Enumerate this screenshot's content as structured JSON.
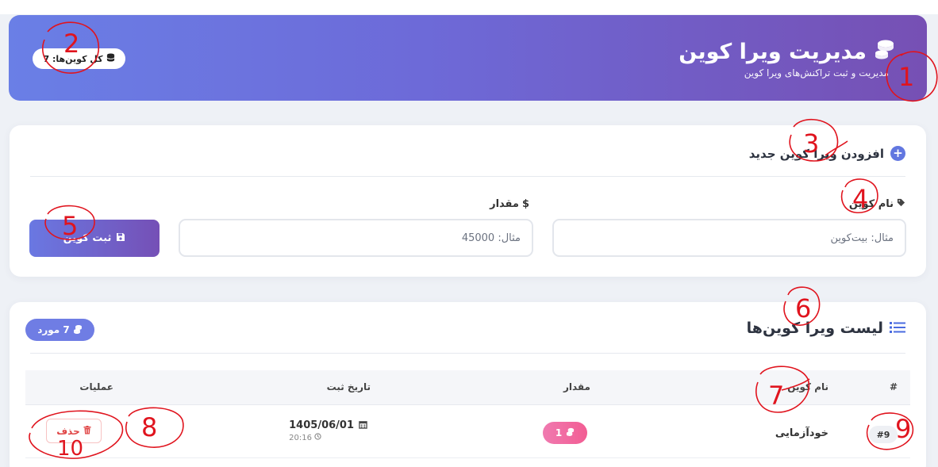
{
  "header": {
    "title": "مدیریت ویرا کوین",
    "subtitle": "مدیریت و ثبت تراکنش‌های ویرا کوین",
    "total_label": "کل کوین‌ها: 7",
    "title_icon": "coins-icon",
    "total_icon": "database-icon"
  },
  "add_form": {
    "heading": "افزودن ویرا کوین جدید",
    "name_label": "نام کوین",
    "name_placeholder": "مثال: بیت‌کوین",
    "amount_label": "مقدار",
    "amount_placeholder": "مثال: 45000",
    "submit_label": "ثبت کوین"
  },
  "list": {
    "heading": "لیست ویرا کوین‌ها",
    "count_label": "7 مورد",
    "columns": [
      "#",
      "نام کوین",
      "مقدار",
      "تاریخ ثبت",
      "عملیات"
    ],
    "rows": [
      {
        "id": "#9",
        "name": "خودآزمایی",
        "amount": "1",
        "date": "1405/06/01",
        "time": "20:16",
        "delete_label": "حذف"
      }
    ]
  },
  "annotations": [
    "1",
    "2",
    "3",
    "4",
    "5",
    "6",
    "7",
    "8",
    "9",
    "10"
  ],
  "colors": {
    "header_start": "#6a7fe6",
    "header_end": "#7650b4",
    "accent": "#6277e0",
    "amount_pill": "#f25d93",
    "delete": "#e04646",
    "annotation": "#e0141e"
  }
}
